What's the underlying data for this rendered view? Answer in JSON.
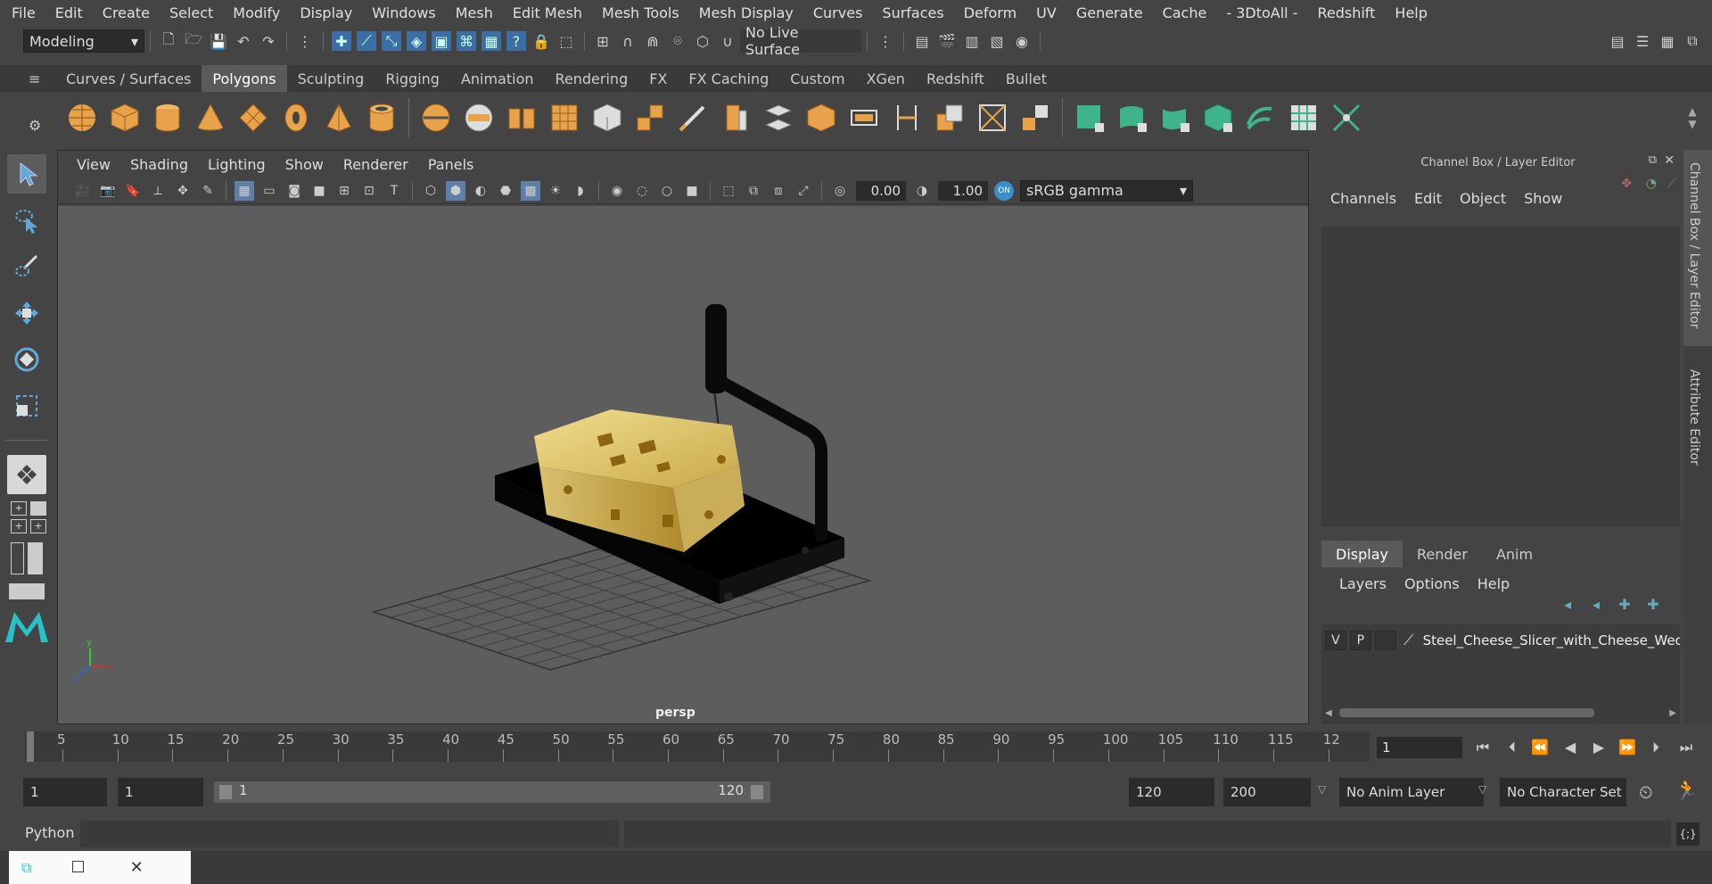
{
  "menubar": {
    "items": [
      "File",
      "Edit",
      "Create",
      "Select",
      "Modify",
      "Display",
      "Windows",
      "Mesh",
      "Edit Mesh",
      "Mesh Tools",
      "Mesh Display",
      "Curves",
      "Surfaces",
      "Deform",
      "UV",
      "Generate",
      "Cache",
      "- 3DtoAll -",
      "Redshift",
      "Help"
    ]
  },
  "statusline": {
    "mode": "Modeling",
    "live_surface": "No Live Surface"
  },
  "shelf": {
    "tabs": [
      "Curves / Surfaces",
      "Polygons",
      "Sculpting",
      "Rigging",
      "Animation",
      "Rendering",
      "FX",
      "FX Caching",
      "Custom",
      "XGen",
      "Redshift",
      "Bullet"
    ],
    "active_tab": "Polygons"
  },
  "viewport": {
    "menu": [
      "View",
      "Shading",
      "Lighting",
      "Show",
      "Renderer",
      "Panels"
    ],
    "exposure": "0.00",
    "gamma": "1.00",
    "color_space": "sRGB gamma",
    "camera_label": "persp"
  },
  "channel_box": {
    "title": "Channel Box / Layer Editor",
    "menu": [
      "Channels",
      "Edit",
      "Object",
      "Show"
    ]
  },
  "layer_editor": {
    "tabs": [
      "Display",
      "Render",
      "Anim"
    ],
    "menu": [
      "Layers",
      "Options",
      "Help"
    ],
    "layer": {
      "v": "V",
      "p": "P",
      "name": "Steel_Cheese_Slicer_with_Cheese_Wec"
    }
  },
  "side_tabs": {
    "channel_box": "Channel Box / Layer Editor",
    "attribute_editor": "Attribute Editor"
  },
  "timeline": {
    "ticks": [
      "5",
      "10",
      "15",
      "20",
      "25",
      "30",
      "35",
      "40",
      "45",
      "50",
      "55",
      "60",
      "65",
      "70",
      "75",
      "80",
      "85",
      "90",
      "95",
      "100",
      "105",
      "110",
      "115",
      "12"
    ],
    "start_label": "1",
    "current_frame": "1"
  },
  "range": {
    "start": "1",
    "playback_start": "1",
    "slider_start": "1",
    "slider_end": "120",
    "playback_end": "120",
    "end": "200",
    "anim_layer": "No Anim Layer",
    "character_set": "No Character Set"
  },
  "cmdline": {
    "language": "Python"
  },
  "colors": {
    "accent": "#5d7fa8",
    "shelf_orange": "#e8a34a",
    "shelf_green": "#3fb38a"
  }
}
